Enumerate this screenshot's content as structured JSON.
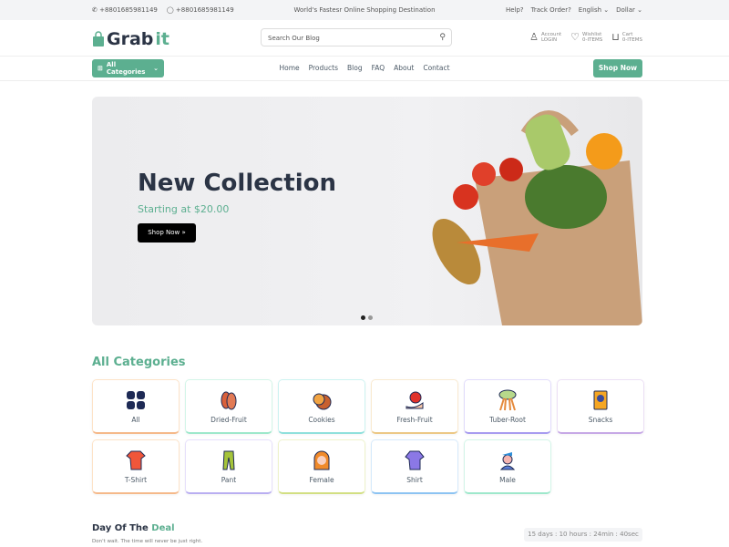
{
  "topbar": {
    "phone": "+8801685981149",
    "whatsapp": "+8801685981149",
    "tagline": "World's Fastesr Online Shopping Destination",
    "help": "Help?",
    "track": "Track Order?",
    "language": "English",
    "currency": "Dollar"
  },
  "header": {
    "logo_prefix": "Grab",
    "logo_suffix": "it",
    "search_placeholder": "Search Our Blog",
    "account": {
      "label": "Account",
      "sub": "LOGIN"
    },
    "wishlist": {
      "label": "Wishlist",
      "sub": "0-ITEMS"
    },
    "cart": {
      "label": "Cart",
      "sub": "0-ITEMS"
    }
  },
  "nav": {
    "all_categories": "All Categories",
    "items": [
      "Home",
      "Products",
      "Blog",
      "FAQ",
      "About",
      "Contact"
    ],
    "shop_now": "Shop Now"
  },
  "hero": {
    "title": "New Collection",
    "subtitle": "Starting at $20.00",
    "button": "Shop Now"
  },
  "categories": {
    "title": "All Categories",
    "items": [
      "All",
      "Dried-Fruit",
      "Cookies",
      "Fresh-Fruit",
      "Tuber-Root",
      "Snacks",
      "T-Shirt",
      "Pant",
      "Female",
      "Shirt",
      "Male"
    ]
  },
  "deal": {
    "title_prefix": "Day Of The ",
    "title_accent": "Deal",
    "subtitle": "Don't wait. The time will never be just right.",
    "timer": "15 days : 10 hours : 24min : 40sec"
  },
  "colors": {
    "accent": "#5caf90",
    "dark": "#2b3445"
  }
}
